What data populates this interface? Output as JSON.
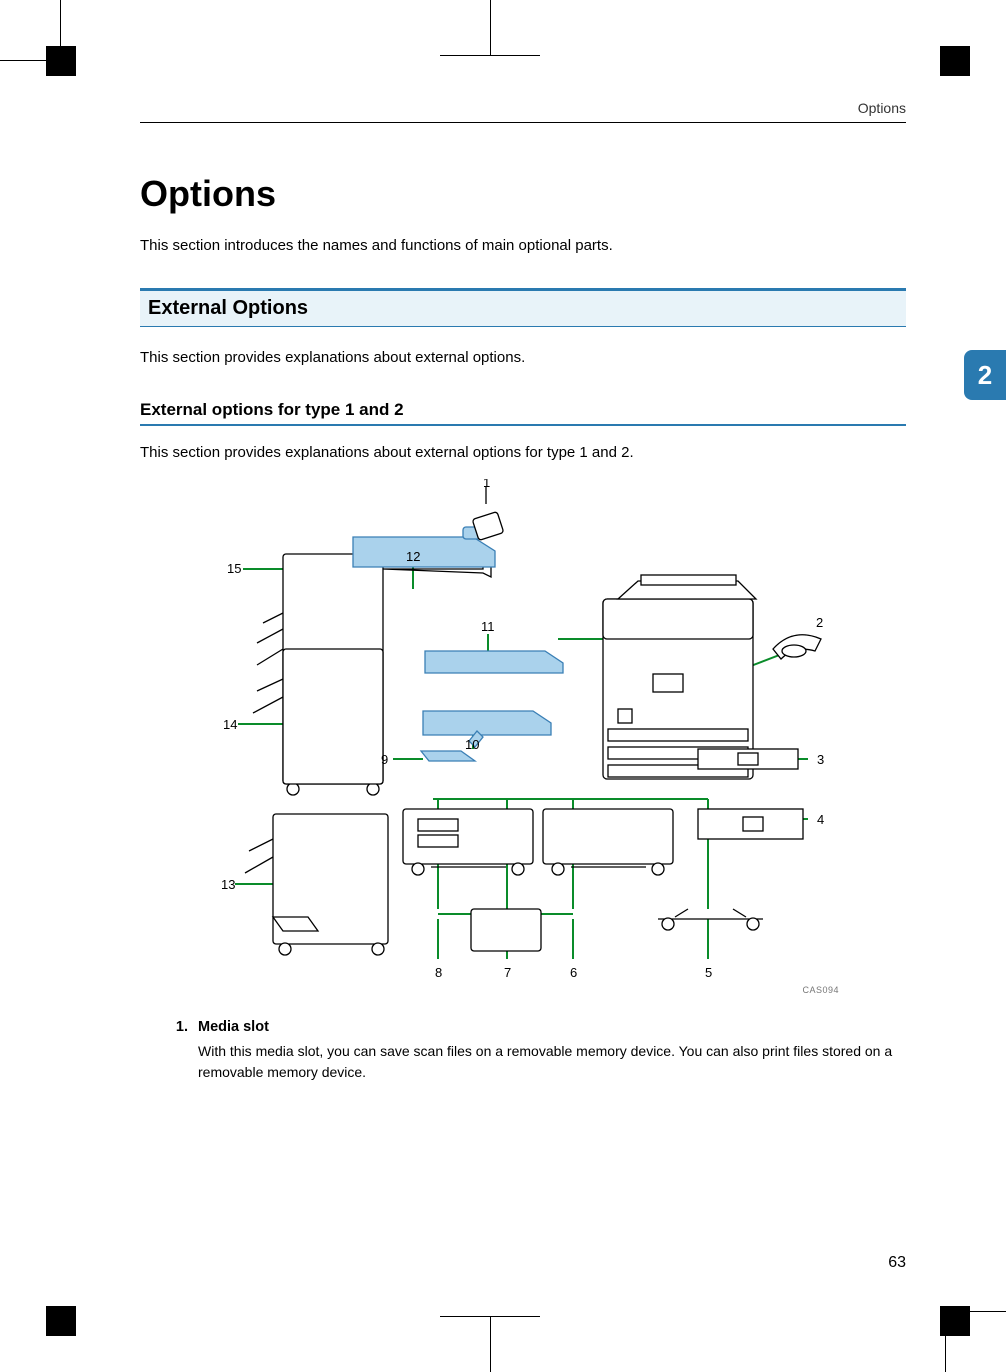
{
  "header": {
    "running": "Options"
  },
  "title": "Options",
  "intro": "This section introduces the names and functions of main optional parts.",
  "h2": "External Options",
  "h2_body": "This section provides explanations about external options.",
  "h3": "External options for type 1 and 2",
  "h3_body": "This section provides explanations about external options for type 1 and 2.",
  "chapter_tab": "2",
  "figure": {
    "id": "CAS094",
    "callouts": [
      "1",
      "2",
      "3",
      "4",
      "5",
      "6",
      "7",
      "8",
      "9",
      "10",
      "11",
      "12",
      "13",
      "14",
      "15"
    ]
  },
  "list": {
    "num": "1.",
    "term": "Media slot",
    "desc": "With this media slot, you can save scan files on a removable memory device. You can also print files stored on a removable memory device."
  },
  "page_number": "63"
}
